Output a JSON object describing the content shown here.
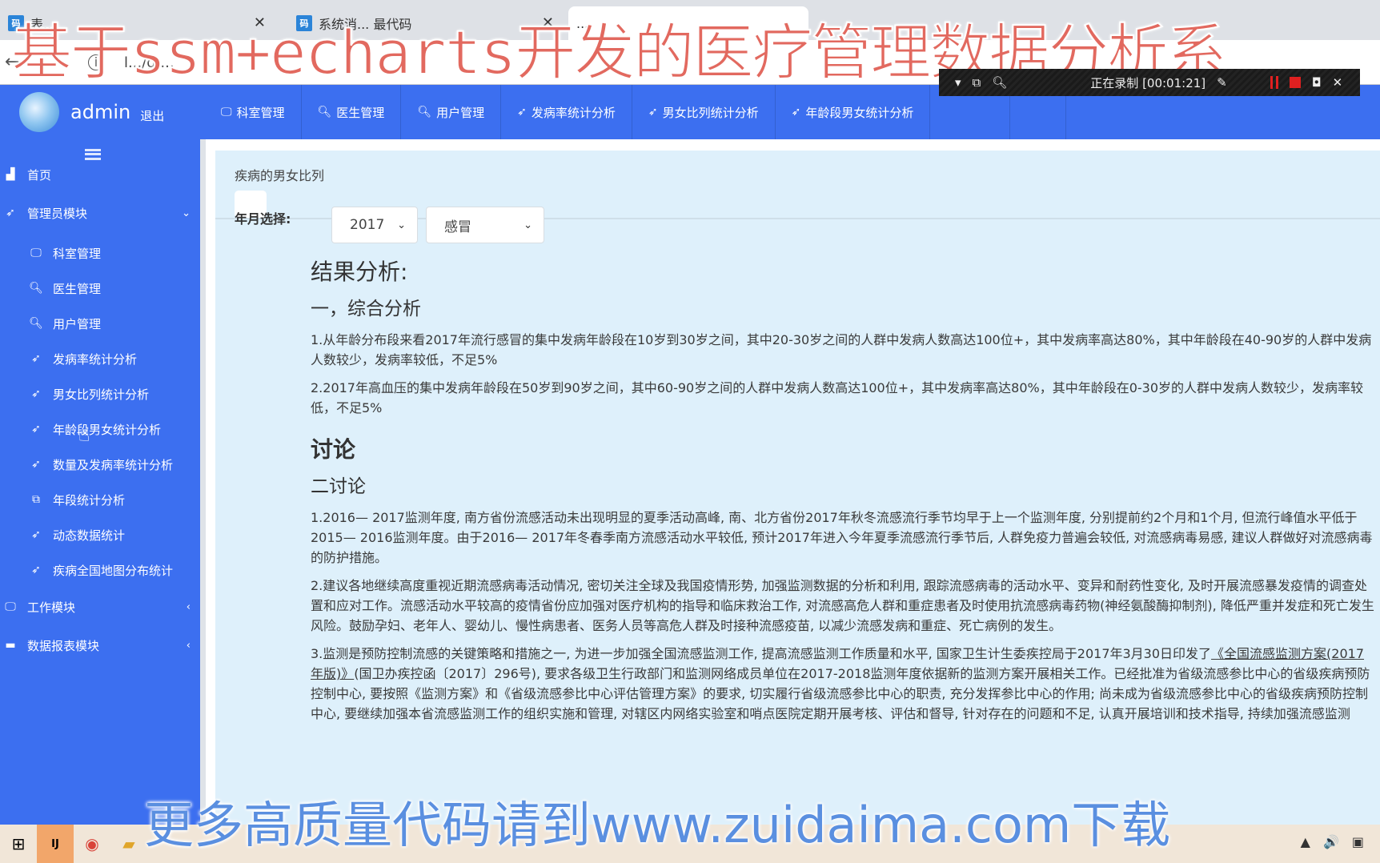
{
  "browser": {
    "tabs": [
      {
        "label": "表...",
        "favicon": "码",
        "active": false
      },
      {
        "label": "系统消... 最代码",
        "favicon": "码",
        "active": false
      },
      {
        "label": "...",
        "favicon": "",
        "active": true
      }
    ],
    "url": "l.../g,...",
    "recording": {
      "label": "正在录制 [00:01:21]"
    }
  },
  "overlays": {
    "top_caption": "基于ssm+echarts开发的医疗管理数据分析系",
    "bottom_caption": "更多高质量代码请到www.zuidaima.com下载"
  },
  "header": {
    "username": "admin",
    "logout": "退出",
    "nav": [
      {
        "icon": "monitor-icon",
        "glyph": "🖵",
        "label": "科室管理"
      },
      {
        "icon": "search-icon",
        "glyph": "🔍︎",
        "label": "医生管理"
      },
      {
        "icon": "search-icon",
        "glyph": "🔍︎",
        "label": "用户管理"
      },
      {
        "icon": "paper-plane-icon",
        "glyph": "➶",
        "label": "发病率统计分析"
      },
      {
        "icon": "paper-plane-icon",
        "glyph": "➶",
        "label": "男女比列统计分析"
      },
      {
        "icon": "paper-plane-icon",
        "glyph": "➶",
        "label": "年龄段男女统计分析"
      }
    ]
  },
  "sidebar": {
    "home": {
      "label": "首页",
      "glyph": "▟"
    },
    "admin_module": {
      "label": "管理员模块",
      "glyph": "➶",
      "expanded": true
    },
    "admin_items": [
      {
        "label": "科室管理",
        "glyph": "🖵",
        "icon": "monitor-icon"
      },
      {
        "label": "医生管理",
        "glyph": "🔍︎",
        "icon": "search-icon"
      },
      {
        "label": "用户管理",
        "glyph": "🔍︎",
        "icon": "search-icon"
      },
      {
        "label": "发病率统计分析",
        "glyph": "➶",
        "icon": "paper-plane-icon"
      },
      {
        "label": "男女比列统计分析",
        "glyph": "➶",
        "icon": "paper-plane-icon"
      },
      {
        "label": "年龄段男女统计分析",
        "glyph": "➶",
        "icon": "paper-plane-icon"
      },
      {
        "label": "数量及发病率统计分析",
        "glyph": "➶",
        "icon": "paper-plane-icon"
      },
      {
        "label": "年段统计分析",
        "glyph": "⧉",
        "icon": "clone-icon"
      },
      {
        "label": "动态数据统计",
        "glyph": "➶",
        "icon": "paper-plane-icon"
      },
      {
        "label": "疾病全国地图分布统计",
        "glyph": "➶",
        "icon": "paper-plane-icon"
      }
    ],
    "work_module": {
      "label": "工作模块",
      "glyph": "🖵"
    },
    "report_module": {
      "label": "数据报表模块",
      "glyph": "▬"
    }
  },
  "main": {
    "panel_title": "疾病的男女比列",
    "filter_label": "年月选择:",
    "year_select": {
      "value": "2017"
    },
    "disease_select": {
      "value": "感冒"
    },
    "result_heading": "结果分析:",
    "section1_heading": "一，综合分析",
    "section1_paragraphs": [
      "1.从年龄分布段来看2017年流行感冒的集中发病年龄段在10岁到30岁之间，其中20-30岁之间的人群中发病人数高达100位+，其中发病率高达80%，其中年龄段在40-90岁的人群中发病人数较少，发病率较低，不足5%",
      "2.2017年高血压的集中发病年龄段在50岁到90岁之间，其中60-90岁之间的人群中发病人数高达100位+，其中发病率高达80%，其中年龄段在0-30岁的人群中发病人数较少，发病率较低，不足5%"
    ],
    "discussion_heading": "讨论",
    "section2_heading": "二讨论",
    "discussion_p1": "1.2016— 2017监测年度, 南方省份流感活动未出现明显的夏季活动高峰, 南、北方省份2017年秋冬流感流行季节均早于上一个监测年度, 分别提前约2个月和1个月, 但流行峰值水平低于2015— 2016监测年度。由于2016— 2017年冬春季南方流感活动水平较低, 预计2017年进入今年夏季流感流行季节后, 人群免疫力普遍会较低, 对流感病毒易感, 建议人群做好对流感病毒的防护措施。",
    "discussion_p2": "2.建议各地继续高度重视近期流感病毒活动情况, 密切关注全球及我国疫情形势, 加强监测数据的分析和利用, 跟踪流感病毒的活动水平、变异和耐药性变化, 及时开展流感暴发疫情的调查处置和应对工作。流感活动水平较高的疫情省份应加强对医疗机构的指导和临床救治工作, 对流感高危人群和重症患者及时使用抗流感病毒药物(神经氨酸酶抑制剂), 降低严重并发症和死亡发生风险。鼓励孕妇、老年人、婴幼儿、慢性病患者、医务人员等高危人群及时接种流感疫苗, 以减少流感发病和重症、死亡病例的发生。",
    "discussion_p3_before": "3.监测是预防控制流感的关键策略和措施之一, 为进一步加强全国流感监测工作, 提高流感监测工作质量和水平, 国家卫生计生委疾控局于2017年3月30日印发了",
    "discussion_p3_link": "《全国流感监测方案(2017年版)》",
    "discussion_p3_after": "(国卫办疾控函〔2017〕296号), 要求各级卫生行政部门和监测网络成员单位在2017-2018监测年度依据新的监测方案开展相关工作。已经批准为省级流感参比中心的省级疾病预防控制中心, 要按照《监测方案》和《省级流感参比中心评估管理方案》的要求, 切实履行省级流感参比中心的职责, 充分发挥参比中心的作用; 尚未成为省级流感参比中心的省级疾病预防控制中心, 要继续加强本省流感监测工作的组织实施和管理, 对辖区内网络实验室和哨点医院定期开展考核、评估和督导, 针对存在的问题和不足, 认真开展培训和技术指导, 持续加强流感监测"
  },
  "taskbar": {
    "apps": [
      {
        "icon": "windows-start-icon",
        "glyph": "⊞"
      },
      {
        "icon": "intellij-icon",
        "glyph": "IJ"
      },
      {
        "icon": "chrome-icon",
        "glyph": "◉"
      },
      {
        "icon": "file-explorer-icon",
        "glyph": "▰"
      }
    ],
    "tray": [
      "▲",
      "🔊",
      "▣"
    ]
  },
  "colors": {
    "primary_blue": "#3c6ff0",
    "panel_bg": "#def0fb",
    "overlay_red": "#e2695f",
    "overlay_blue": "#5a8fe0"
  }
}
